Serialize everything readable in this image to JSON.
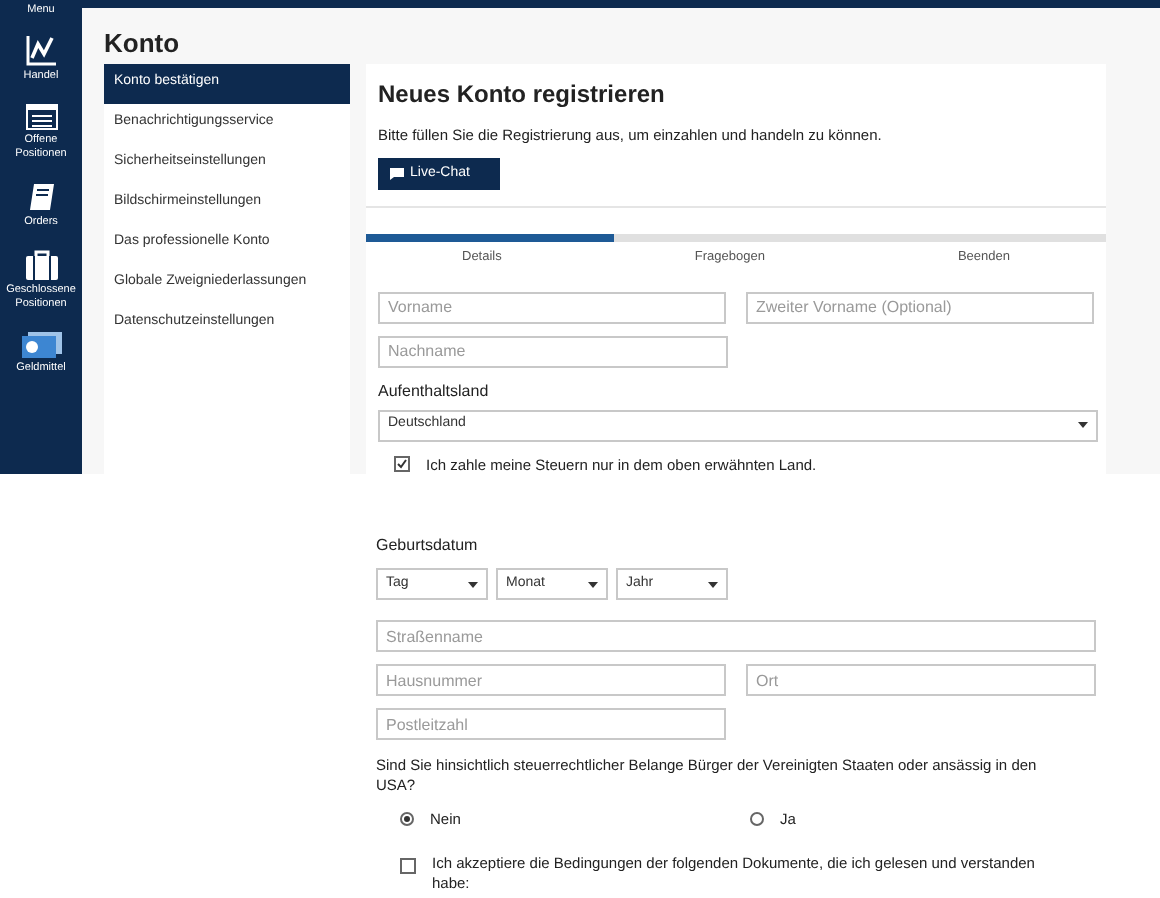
{
  "nav": [
    {
      "label": "Menu"
    },
    {
      "label": "Handel"
    },
    {
      "label": "Offene Positionen"
    },
    {
      "label": "Orders"
    },
    {
      "label": "Geschlossene Positionen"
    },
    {
      "label": "Geldmittel"
    }
  ],
  "page_title": "Konto",
  "submenu": [
    {
      "label": "Konto bestätigen",
      "selected": true
    },
    {
      "label": "Benachrichtigungsservice",
      "selected": false
    },
    {
      "label": "Sicherheitseinstellungen",
      "selected": false
    },
    {
      "label": "Bildschirmeinstellungen",
      "selected": false
    },
    {
      "label": "Das professionelle Konto",
      "selected": false
    },
    {
      "label": "Globale Zweigniederlassungen",
      "selected": false
    },
    {
      "label": "Datenschutzeinstellungen",
      "selected": false
    }
  ],
  "form": {
    "title": "Neues Konto registrieren",
    "intro": "Bitte füllen Sie die Registrierung aus, um einzahlen und handeln zu können.",
    "chat_button": "Live-Chat",
    "progress": {
      "level": 0.335,
      "steps": [
        "Details",
        "Fragebogen",
        "Beenden"
      ]
    },
    "first_name": {
      "placeholder": "Vorname"
    },
    "middle_name": {
      "placeholder": "Zweiter Vorname (Optional)"
    },
    "last_name": {
      "placeholder": "Nachname"
    },
    "country_label": "Aufenthaltsland",
    "country": "Deutschland",
    "tax_check": {
      "label": "Ich zahle meine Steuern nur in dem oben erwähnten Land.",
      "checked": true
    },
    "birth_label": "Geburtsdatum",
    "birth": [
      "Tag",
      "Monat",
      "Jahr"
    ],
    "street": {
      "placeholder": "Straßenname"
    },
    "house": {
      "placeholder": "Hausnummer"
    },
    "city": {
      "placeholder": "Ort"
    },
    "zip": {
      "placeholder": "Postleitzahl"
    },
    "us_question": "Sind Sie hinsichtlich steuerrechtlicher Belange Bürger der Vereinigten Staaten oder ansässig in den USA?",
    "us_options": [
      {
        "label": "Nein",
        "selected": true
      },
      {
        "label": "Ja",
        "selected": false
      }
    ],
    "terms": {
      "label": "Ich akzeptiere die Bedingungen der folgenden Dokumente, die ich gelesen und verstanden habe:",
      "checked": false
    }
  }
}
